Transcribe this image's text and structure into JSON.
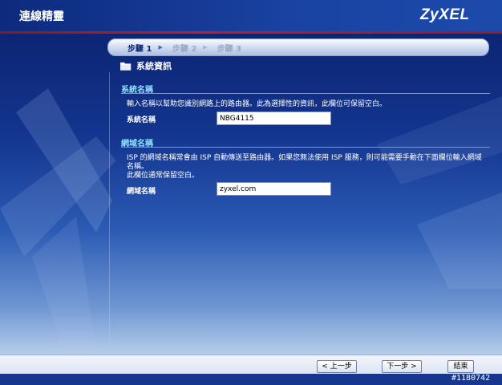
{
  "header": {
    "title": "連線精靈",
    "logo": "ZyXEL"
  },
  "steps": [
    {
      "label": "步驟 1",
      "active": true
    },
    {
      "label": "步驟 2",
      "active": false
    },
    {
      "label": "步驟 3",
      "active": false
    }
  ],
  "panel": {
    "heading": "系統資訊",
    "icon": "folder-icon"
  },
  "system_section": {
    "title": "系統名稱",
    "description": "輸入名稱以幫助您識別網路上的路由器。此為選擇性的資訊，此欄位可保留空白。",
    "field_label": "系統名稱",
    "field_value": "NBG4115"
  },
  "domain_section": {
    "title": "網域名稱",
    "description_line1": "ISP 的網域名稱常會由 ISP 自動傳送至路由器。如果您無法使用 ISP 服務，則可能需要手動在下面欄位輸入網域名稱。",
    "description_line2": "此欄位通常保留空白。",
    "field_label": "網域名稱",
    "field_value": "zyxel.com"
  },
  "footer": {
    "back_label": "< 上一步",
    "next_label": "下一步 >",
    "finish_label": "結束"
  },
  "watermark": "#1180742",
  "colors": {
    "section_title": "#8fe0ff",
    "header_line": "#b12333",
    "background": "#13358f"
  }
}
